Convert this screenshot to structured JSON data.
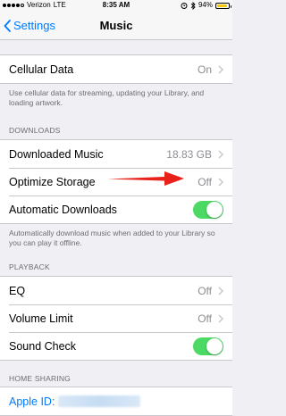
{
  "status_bar": {
    "carrier": "Verizon",
    "network": "LTE",
    "time": "8:35 AM",
    "battery_percent": "94%",
    "battery_level": 0.94,
    "signal_bars_filled": 4,
    "signal_bars_total": 5
  },
  "nav": {
    "back_label": "Settings",
    "title": "Music"
  },
  "cellular": {
    "label": "Cellular Data",
    "value": "On",
    "footer": "Use cellular data for streaming, updating your Library, and loading artwork."
  },
  "downloads": {
    "header": "DOWNLOADS",
    "downloaded_music": {
      "label": "Downloaded Music",
      "value": "18.83 GB"
    },
    "optimize_storage": {
      "label": "Optimize Storage",
      "value": "Off"
    },
    "automatic_downloads": {
      "label": "Automatic Downloads",
      "on": true
    },
    "footer": "Automatically download music when added to your Library so you can play it offline."
  },
  "playback": {
    "header": "PLAYBACK",
    "eq": {
      "label": "EQ",
      "value": "Off"
    },
    "volume_limit": {
      "label": "Volume Limit",
      "value": "Off"
    },
    "sound_check": {
      "label": "Sound Check",
      "on": true
    }
  },
  "home_sharing": {
    "header": "HOME SHARING",
    "apple_id_label": "Apple ID:"
  },
  "colors": {
    "accent": "#007aff",
    "toggle_on": "#4cd964",
    "annotation_arrow": "#e8221b",
    "battery": "#f6c900"
  },
  "icons": {
    "back": "chevron-left-icon",
    "disclosure": "chevron-right-icon",
    "bluetooth": "bluetooth-icon",
    "alarm": "alarm-icon"
  }
}
